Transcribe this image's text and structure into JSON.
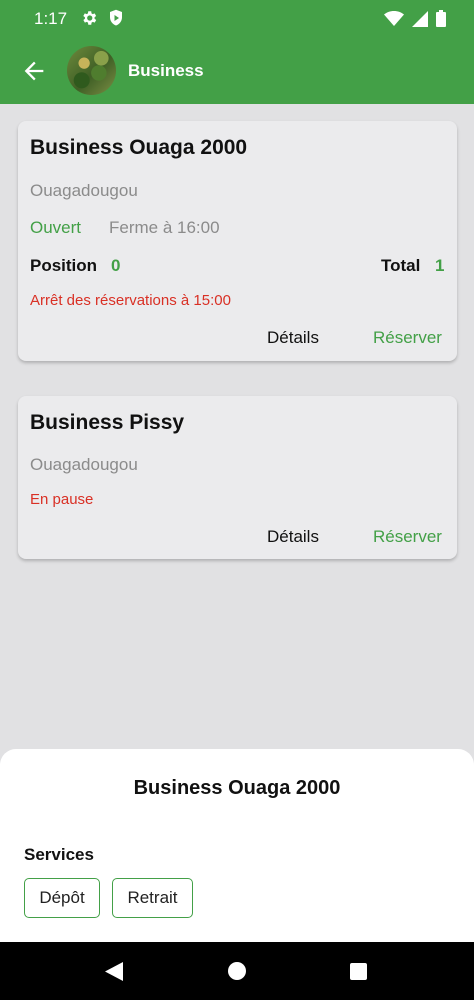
{
  "status_bar": {
    "time": "1:17",
    "left_icons": [
      "gear-icon",
      "shield-play-icon"
    ],
    "right_icons": [
      "wifi-icon",
      "cell-signal-icon",
      "battery-icon"
    ],
    "color": "#43a047"
  },
  "app_bar": {
    "title": "Business",
    "back_icon": "arrow-left-icon",
    "color": "#43a047"
  },
  "cards": [
    {
      "title": "Business Ouaga 2000",
      "city": "Ouagadougou",
      "status": "Ouvert",
      "closing": "Ferme à 16:00",
      "position_label": "Position",
      "position_value": "0",
      "total_label": "Total",
      "total_value": "1",
      "note": "Arrêt des réservations à 15:00",
      "details_label": "Détails",
      "reserve_label": "Réserver"
    },
    {
      "title": "Business Pissy",
      "city": "Ouagadougou",
      "note": "En pause",
      "details_label": "Détails",
      "reserve_label": "Réserver"
    }
  ],
  "sheet": {
    "title": "Business Ouaga 2000",
    "services_label": "Services",
    "services": [
      "Dépôt",
      "Retrait"
    ]
  },
  "nav_bar": {
    "icons": [
      "back-triangle-icon",
      "home-circle-icon",
      "recents-square-icon"
    ]
  },
  "colors": {
    "accent": "#43a047",
    "warning": "#d93025",
    "muted": "#8b8b8b"
  }
}
